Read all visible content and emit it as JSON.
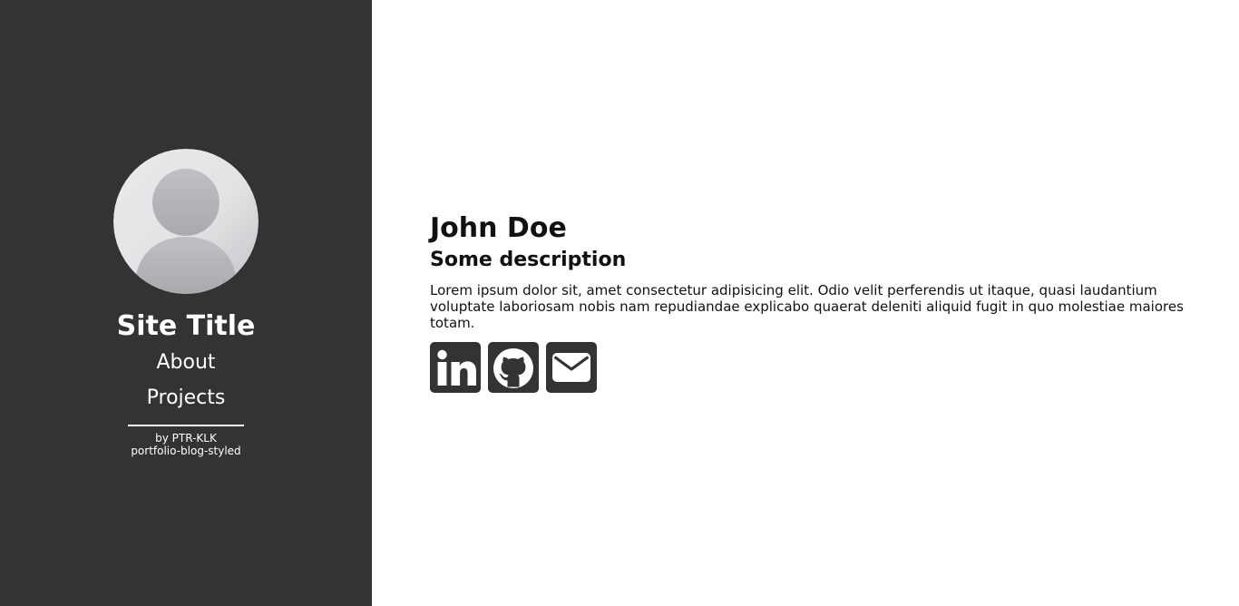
{
  "sidebar": {
    "site_title": "Site Title",
    "nav": {
      "about": "About",
      "projects": "Projects"
    },
    "credits": {
      "author": "by PTR-KLK",
      "project": "portfolio-blog-styled"
    },
    "avatar_icon": "user-placeholder-icon"
  },
  "main": {
    "name": "John Doe",
    "description": "Some description",
    "bio": "Lorem ipsum dolor sit, amet consectetur adipisicing elit. Odio velit perferendis ut itaque, quasi laudantium voluptate laboriosam nobis nam repudiandae explicabo quaerat deleniti aliquid fugit in quo molestiae maiores totam.",
    "socials": [
      {
        "icon": "linkedin-icon"
      },
      {
        "icon": "github-icon"
      },
      {
        "icon": "envelope-icon"
      }
    ]
  },
  "colors": {
    "sidebar_bg": "#333333",
    "main_bg": "#ffffff",
    "text_dark": "#111111",
    "icon_bg": "#333333"
  }
}
